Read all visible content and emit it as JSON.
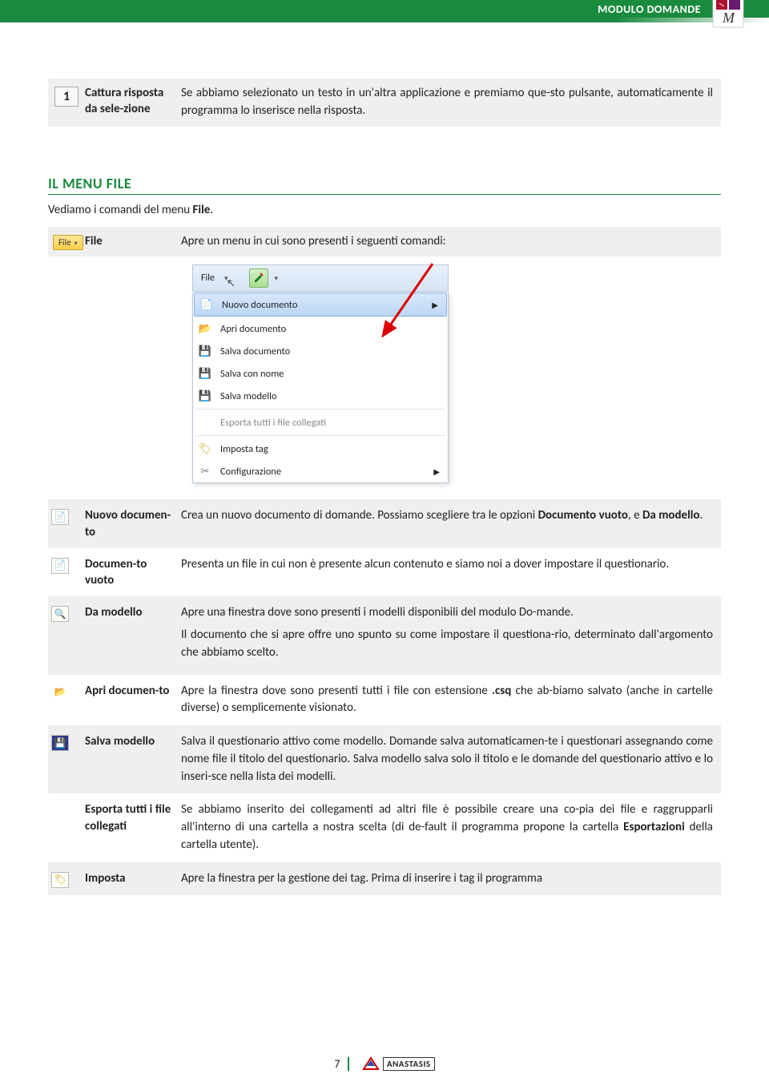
{
  "header": {
    "title": "MODULO DOMANDE"
  },
  "row1": {
    "num": "1",
    "label": "Cattura risposta da sele-zione",
    "desc": "Se abbiamo selezionato un testo in un'altra applicazione e premiamo que-sto pulsante, automaticamente il programma lo inserisce nella risposta."
  },
  "section_title": "IL MENU FILE",
  "intro_prefix": "Vediamo i comandi del menu ",
  "intro_bold": "File",
  "intro_suffix": ".",
  "file_button": "File",
  "file_row": {
    "label": "File",
    "desc": "Apre un menu in cui sono presenti i seguenti comandi:"
  },
  "menu": {
    "toolbar_file": "File",
    "items": [
      {
        "label": "Nuovo documento",
        "selected": true,
        "has_submenu": true,
        "icon": "new-doc"
      },
      {
        "label": "Apri documento",
        "icon": "folder"
      },
      {
        "label": "Salva documento",
        "icon": "save-green"
      },
      {
        "label": "Salva con nome",
        "icon": "save"
      },
      {
        "label": "Salva modello",
        "icon": "save-model"
      },
      {
        "label": "Esporta tutti i file collegati",
        "icon": "",
        "muted": true
      },
      {
        "label": "Imposta tag",
        "icon": "tag"
      },
      {
        "label": "Configurazione",
        "icon": "gear"
      }
    ]
  },
  "rows": [
    {
      "bg": "gray",
      "icon": "new-doc",
      "label": "Nuovo documen-to",
      "desc_parts": [
        "Crea un nuovo documento di domande. Possiamo scegliere tra le opzioni ",
        "Documento vuoto",
        ", e ",
        "Da modello",
        "."
      ]
    },
    {
      "bg": "white",
      "icon": "new-doc",
      "label": "Documen-to vuoto",
      "desc": "Presenta un file in cui non è presente alcun contenuto e siamo noi a dover impostare il questionario."
    },
    {
      "bg": "gray",
      "icon": "template",
      "label": "Da modello",
      "desc_parts2": [
        "Apre una finestra dove sono presenti i modelli disponibili del modulo Do-mande.",
        "Il documento che si apre offre uno spunto su come impostare il questiona-rio, determinato dall'argomento che abbiamo scelto."
      ]
    },
    {
      "bg": "white",
      "icon": "folder",
      "label": "Apri documen-to",
      "desc_parts": [
        "Apre la finestra dove sono presenti tutti i file con estensione ",
        ".csq",
        " che ab-biamo salvato (anche in cartelle diverse) o semplicemente visionato."
      ]
    },
    {
      "bg": "gray",
      "icon": "save-model",
      "label": "Salva modello",
      "desc": "Salva il questionario attivo come modello. Domande salva automaticamen-te i questionari assegnando come nome file il titolo del questionario. Salva modello salva solo il titolo e le domande del questionario attivo e lo inseri-sce nella lista dei modelli."
    },
    {
      "bg": "white",
      "icon": "",
      "label": "Esporta tutti i file collegati",
      "desc_parts": [
        "Se abbiamo inserito dei collegamenti ad altri file è possibile creare una co-pia dei file e raggrupparli all'interno di una cartella a nostra scelta (di de-fault il programma propone la cartella ",
        "Esportazioni",
        " della cartella utente)."
      ]
    },
    {
      "bg": "gray",
      "icon": "tag",
      "label": "Imposta",
      "desc": "Apre la finestra per la gestione dei tag. Prima di inserire i tag il programma"
    }
  ],
  "footer": {
    "page": "7",
    "brand": "ANASTASIS"
  }
}
